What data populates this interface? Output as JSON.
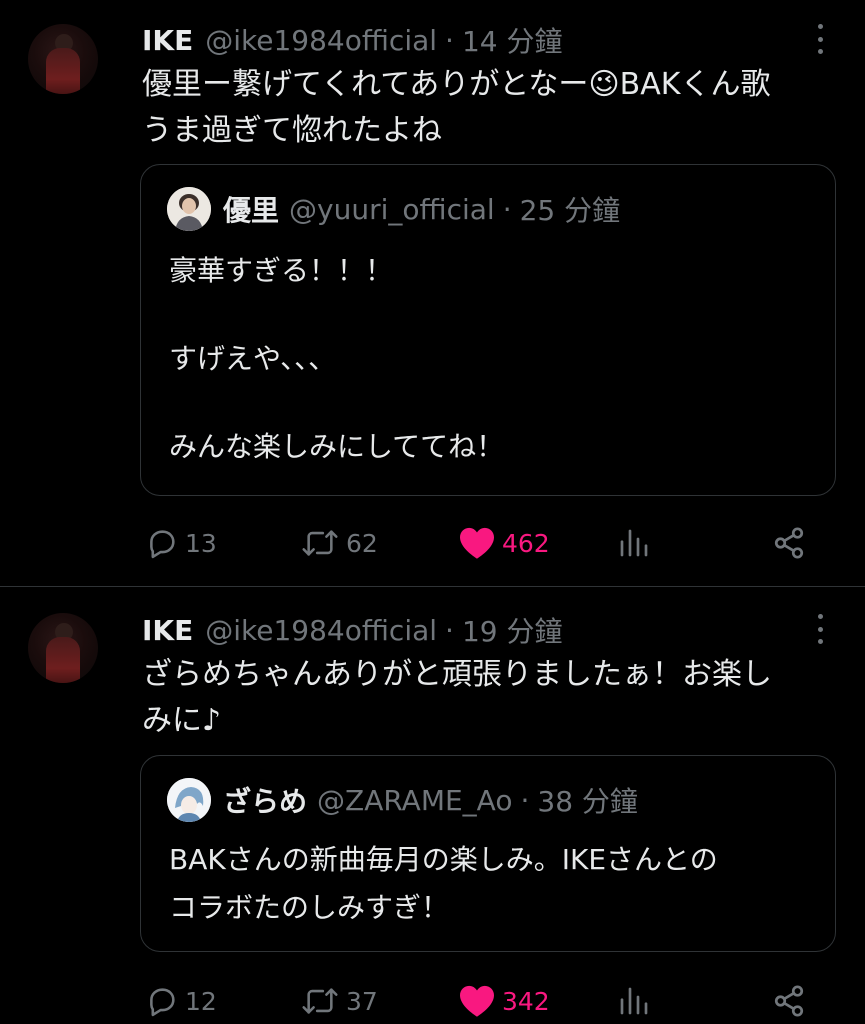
{
  "tweets": [
    {
      "name": "IKE",
      "handle": "@ike1984official",
      "separator": "·",
      "time": "14 分鐘",
      "text_lines": [
        "優里ー繋げてくれてありがとなー😉BAKくん歌",
        "うま過ぎて惚れたよね"
      ],
      "quote": {
        "name": "優里",
        "handle": "@yuuri_official",
        "separator": "·",
        "time": "25 分鐘",
        "text_lines": [
          "豪華すぎる！！！",
          "すげえや、、、",
          "みんな楽しみにしててね！"
        ]
      },
      "actions": {
        "replies": "13",
        "retweets": "62",
        "likes": "462"
      }
    },
    {
      "name": "IKE",
      "handle": "@ike1984official",
      "separator": "·",
      "time": "19 分鐘",
      "text_lines": [
        "ざらめちゃんありがと頑張りましたぁ！お楽し",
        "みに♪"
      ],
      "quote": {
        "name": "ざらめ",
        "handle": "@ZARAME_Ao",
        "separator": "·",
        "time": "38 分鐘",
        "text_lines": [
          "BAKさんの新曲毎月の楽しみ。IKEさんとの",
          "コラボたのしみすぎ！"
        ]
      },
      "actions": {
        "replies": "12",
        "retweets": "37",
        "likes": "342"
      }
    }
  ],
  "icons": {
    "reply": "reply-icon",
    "retweet": "retweet-icon",
    "like": "heart-icon",
    "views": "views-icon",
    "share": "share-icon",
    "more": "more-icon"
  },
  "colors": {
    "background": "#000000",
    "text": "#e7e9ea",
    "muted": "#71767b",
    "border": "#2f3336",
    "like": "#f91880"
  }
}
